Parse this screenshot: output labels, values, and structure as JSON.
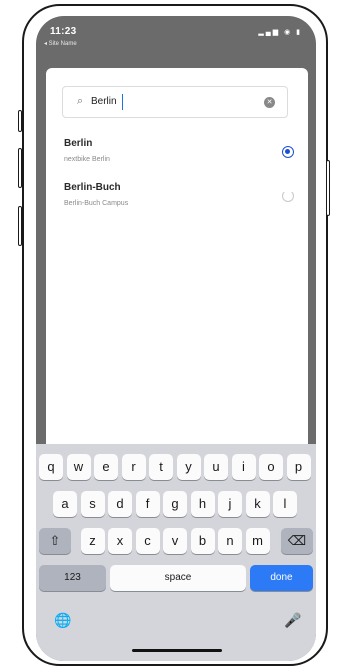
{
  "status_bar": {
    "time": "11:23",
    "back_label": "◂ Site Name",
    "icons": "▂▄▆ ◉ ▮"
  },
  "search": {
    "value": "Berlin",
    "clear_symbol": "✕"
  },
  "results": [
    {
      "title": "Berlin",
      "subtitle": "nextbike Berlin",
      "selected": true
    },
    {
      "title": "Berlin-Buch",
      "subtitle": "Berlin-Buch Campus",
      "selected": false
    }
  ],
  "keyboard": {
    "row1": [
      "q",
      "w",
      "e",
      "r",
      "t",
      "y",
      "u",
      "i",
      "o",
      "p"
    ],
    "row2": [
      "a",
      "s",
      "d",
      "f",
      "g",
      "h",
      "j",
      "k",
      "l"
    ],
    "row3": [
      "z",
      "x",
      "c",
      "v",
      "b",
      "n",
      "m"
    ],
    "shift_symbol": "⇧",
    "delete_symbol": "⌫",
    "numbers_label": "123",
    "space_label": "space",
    "done_label": "done",
    "globe_symbol": "🌐",
    "mic_symbol": "🎤"
  },
  "colors": {
    "accent": "#2c7af6",
    "radio": "#1b4fd6",
    "overlay": "#6b6b6b",
    "keyboard_bg": "#d3d5da"
  }
}
